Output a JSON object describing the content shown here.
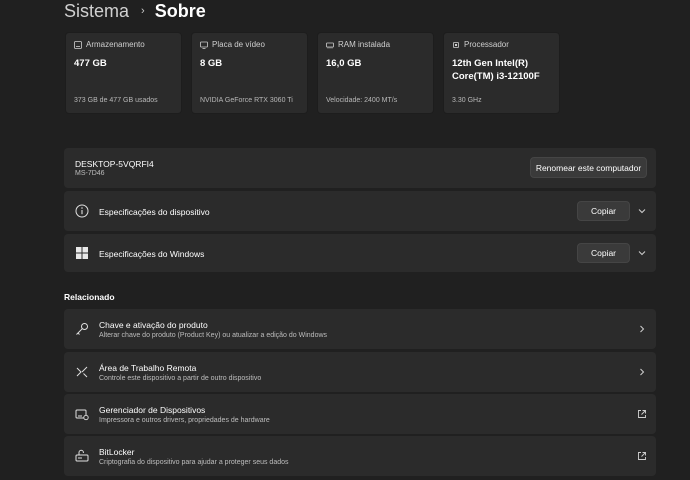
{
  "breadcrumb": {
    "parent": "Sistema",
    "separator": "›",
    "current": "Sobre"
  },
  "cards": [
    {
      "icon": "storage-icon",
      "title": "Armazenamento",
      "value_lines": [
        "477 GB"
      ],
      "sub": "373 GB de 477 GB usados"
    },
    {
      "icon": "display-adapter-icon",
      "title": "Placa de vídeo",
      "value_lines": [
        "8 GB"
      ],
      "sub": "NVIDIA GeForce RTX 3060 Ti"
    },
    {
      "icon": "ram-icon",
      "title": "RAM instalada",
      "value_lines": [
        "16,0 GB"
      ],
      "sub": "Velocidade: 2400 MT/s"
    },
    {
      "icon": "processor-icon",
      "title": "Processador",
      "value_lines": [
        "12th Gen Intel(R)",
        "Core(TM) i3-12100F"
      ],
      "sub": "3.30 GHz"
    }
  ],
  "device": {
    "name": "DESKTOP-5VQRFI4",
    "model": "MS-7D46",
    "rename_label": "Renomear este computador"
  },
  "specs": [
    {
      "icon": "info-icon",
      "title": "Especificações do dispositivo",
      "button": "Copiar"
    },
    {
      "icon": "windows-logo-icon",
      "title": "Especificações do Windows",
      "button": "Copiar"
    }
  ],
  "related": {
    "heading": "Relacionado",
    "items": [
      {
        "icon": "key-icon",
        "title": "Chave e ativação do produto",
        "desc": "Alterar chave do produto (Product Key) ou atualizar a edição do Windows",
        "action": "chevron-right-icon"
      },
      {
        "icon": "remote-desktop-icon",
        "title": "Área de Trabalho Remota",
        "desc": "Controle este dispositivo a partir de outro dispositivo",
        "action": "chevron-right-icon"
      },
      {
        "icon": "device-manager-icon",
        "title": "Gerenciador de Dispositivos",
        "desc": "Impressora e outros drivers, propriedades de hardware",
        "action": "external-link-icon"
      },
      {
        "icon": "bitlocker-icon",
        "title": "BitLocker",
        "desc": "Criptografia do dispositivo para ajudar a proteger seus dados",
        "action": "external-link-icon"
      }
    ]
  }
}
